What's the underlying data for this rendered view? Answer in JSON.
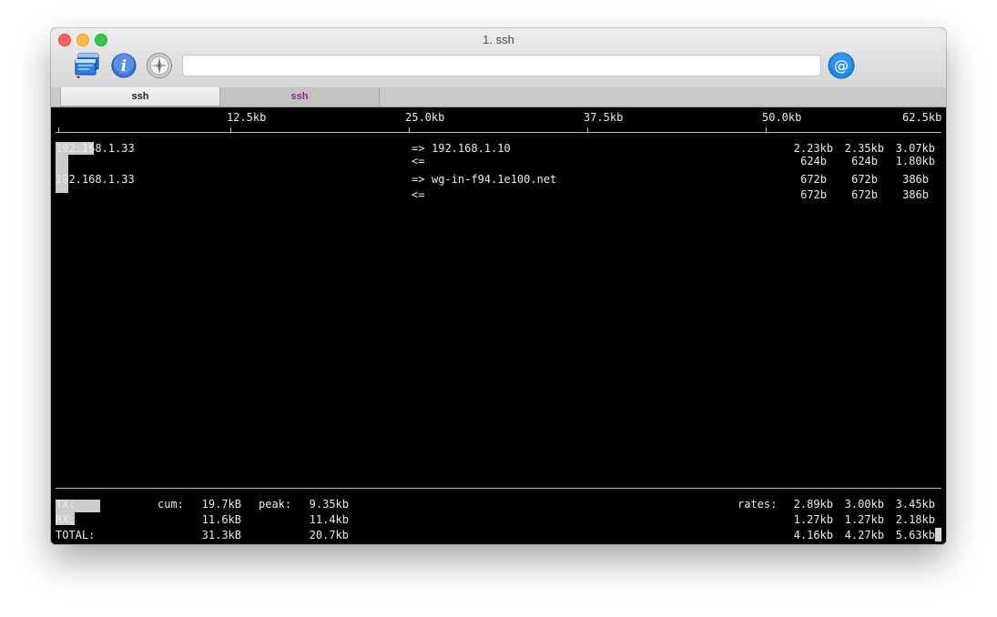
{
  "window": {
    "title": "1. ssh"
  },
  "toolbar": {
    "icons": [
      "windows-icon",
      "info-icon",
      "compass-icon",
      "at-icon"
    ],
    "at_glyph": "@",
    "info_glyph": "i"
  },
  "tabs": [
    {
      "label": "ssh",
      "active": true
    },
    {
      "label": "ssh",
      "active": false,
      "color": "#8a2b8e"
    }
  ],
  "iftop": {
    "scale": [
      "12.5kb",
      "25.0kb",
      "37.5kb",
      "50.0kb",
      "62.5kb"
    ],
    "connections": [
      {
        "src": "192.168.1.33",
        "dst": "192.168.1.10",
        "tx": [
          "2.23kb",
          "2.35kb",
          "3.07kb"
        ],
        "rx": [
          "624b",
          "624b",
          "1.80kb"
        ]
      },
      {
        "src": "192.168.1.33",
        "dst": "wg-in-f94.1e100.net",
        "tx": [
          "672b",
          "672b",
          "386b"
        ],
        "rx": [
          "672b",
          "672b",
          "386b"
        ]
      }
    ],
    "arrow_out": "=>",
    "arrow_in": "<=",
    "footer": {
      "tx_label": "TX:",
      "rx_label": "RX:",
      "total_label": "TOTAL:",
      "cum_label": "cum:",
      "peak_label": "peak:",
      "rates_label": "rates:",
      "tx_cum": "19.7kB",
      "tx_peak": "9.35kb",
      "rx_cum": "11.6kB",
      "rx_peak": "11.4kb",
      "total_cum": "31.3kB",
      "total_peak": "20.7kb",
      "tx_rates": [
        "2.89kb",
        "3.00kb",
        "3.45kb"
      ],
      "rx_rates": [
        "1.27kb",
        "1.27kb",
        "2.18kb"
      ],
      "total_rates": [
        "4.16kb",
        "4.27kb",
        "5.63kb"
      ]
    }
  },
  "colors": {
    "accent_blue": "#1e88e5",
    "terminal_bg": "#000000",
    "terminal_fg": "#ebebeb"
  }
}
